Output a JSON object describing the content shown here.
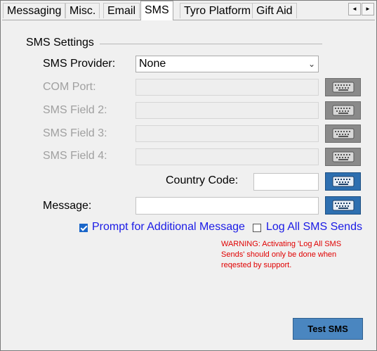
{
  "tabs": [
    {
      "label": "Messaging",
      "active": false
    },
    {
      "label": "Misc.",
      "active": false
    },
    {
      "label": "Email",
      "active": false
    },
    {
      "label": "SMS",
      "active": true
    },
    {
      "label": "Tyro Platform",
      "active": false
    },
    {
      "label": "Gift Aid",
      "active": false
    }
  ],
  "tab_scroll": {
    "left": "◄",
    "right": "►"
  },
  "sms_settings": {
    "section_title": "SMS Settings",
    "provider": {
      "label": "SMS Provider:",
      "value": "None"
    },
    "com_port": {
      "label": "COM Port:",
      "value": ""
    },
    "field2": {
      "label": "SMS Field 2:",
      "value": ""
    },
    "field3": {
      "label": "SMS Field 3:",
      "value": ""
    },
    "field4": {
      "label": "SMS Field 4:",
      "value": ""
    },
    "country_code": {
      "label": "Country Code:",
      "value": ""
    },
    "message": {
      "label": "Message:",
      "value": ""
    },
    "prompt_additional": {
      "label": "Prompt for Additional Message",
      "checked": true
    },
    "log_all": {
      "label": "Log All SMS Sends",
      "checked": false
    },
    "warning": "WARNING: Activating 'Log All SMS Sends' should only be done when reqested by support.",
    "test_button": "Test SMS"
  },
  "colors": {
    "link_blue": "#1a1ae6",
    "warning_red": "#e00000",
    "button_blue": "#4a86c0",
    "keyboard_enabled": "#2e6fb0",
    "keyboard_disabled": "#8a8a8a"
  }
}
